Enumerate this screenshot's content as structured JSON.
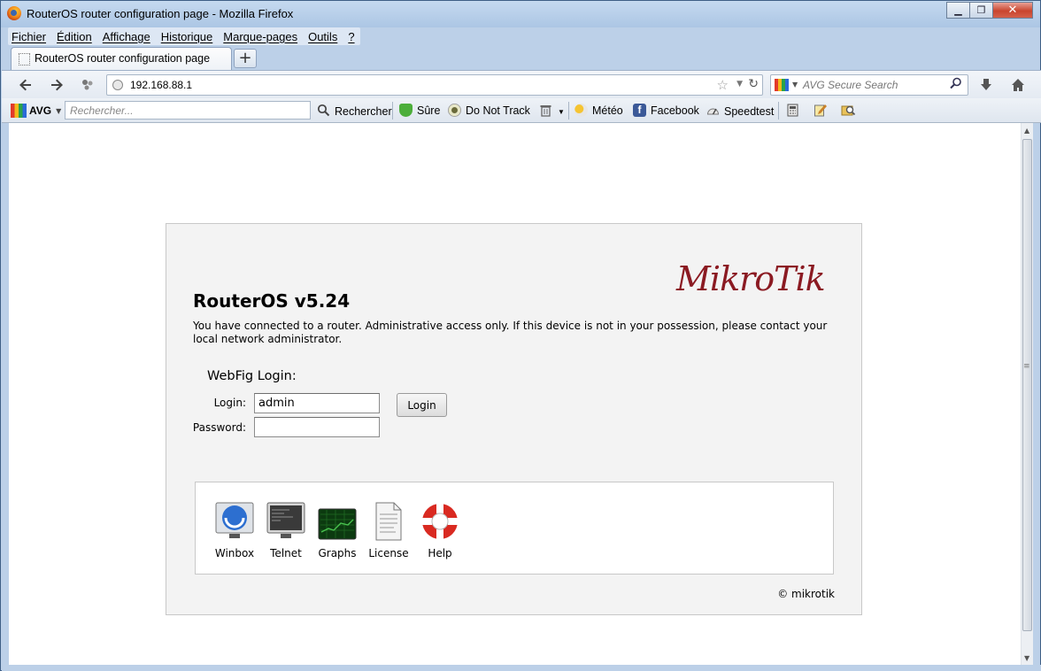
{
  "window": {
    "title": "RouterOS router configuration page - Mozilla Firefox",
    "controls": {
      "minimize": "▁",
      "maximize": "❐",
      "close": "✕"
    }
  },
  "menu": [
    "Fichier",
    "Édition",
    "Affichage",
    "Historique",
    "Marque-pages",
    "Outils",
    "?"
  ],
  "tab": {
    "label": "RouterOS router configuration page",
    "new_tab": "+"
  },
  "navbar": {
    "url": "192.168.88.1",
    "search_placeholder": "AVG Secure Search"
  },
  "avg_toolbar": {
    "brand": "AVG",
    "search_placeholder": "Rechercher...",
    "search_button": "Rechercher",
    "safe": "Sûre",
    "do_not_track": "Do Not Track",
    "weather": "Météo",
    "facebook": "Facebook",
    "speedtest": "Speedtest"
  },
  "page": {
    "heading": "RouterOS v5.24",
    "intro": "You have connected to a router. Administrative access only. If this device is not in your possession, please contact your local network administrator.",
    "login_title": "WebFig Login:",
    "login_label": "Login:",
    "login_value": "admin",
    "password_label": "Password:",
    "password_value": "",
    "login_button": "Login",
    "tools": [
      {
        "label": "Winbox",
        "icon": "winbox-icon"
      },
      {
        "label": "Telnet",
        "icon": "telnet-icon"
      },
      {
        "label": "Graphs",
        "icon": "graphs-icon"
      },
      {
        "label": "License",
        "icon": "license-icon"
      },
      {
        "label": "Help",
        "icon": "help-icon"
      }
    ],
    "copyright": "© mikrotik",
    "logo_text": "MikroTik"
  },
  "colors": {
    "logo": "#8b1a22",
    "card_bg": "#f3f3f3",
    "window_frame": "#bcd0e8"
  }
}
